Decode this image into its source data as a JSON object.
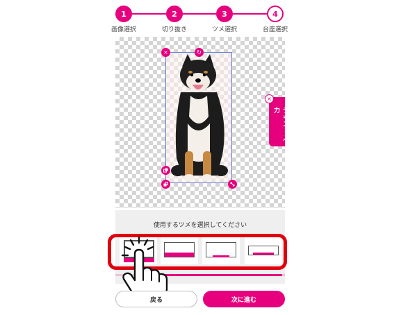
{
  "steps": [
    {
      "number": "1",
      "label": "画像選択",
      "state": "done"
    },
    {
      "number": "2",
      "label": "切り抜き",
      "state": "done"
    },
    {
      "number": "3",
      "label": "ツメ選択",
      "state": "done"
    },
    {
      "number": "4",
      "label": "台座選択",
      "state": "current"
    }
  ],
  "editor": {
    "text_input_tab": "テキスト入力",
    "handles": {
      "delete": "×",
      "rotate": "↻"
    }
  },
  "panel": {
    "title": "使用するツメを選択してください",
    "selected_option": 1,
    "option_count": 4
  },
  "buttons": {
    "back": "戻る",
    "next": "次に進む"
  },
  "colors": {
    "accent": "#e6007e",
    "highlight": "#e00010"
  }
}
